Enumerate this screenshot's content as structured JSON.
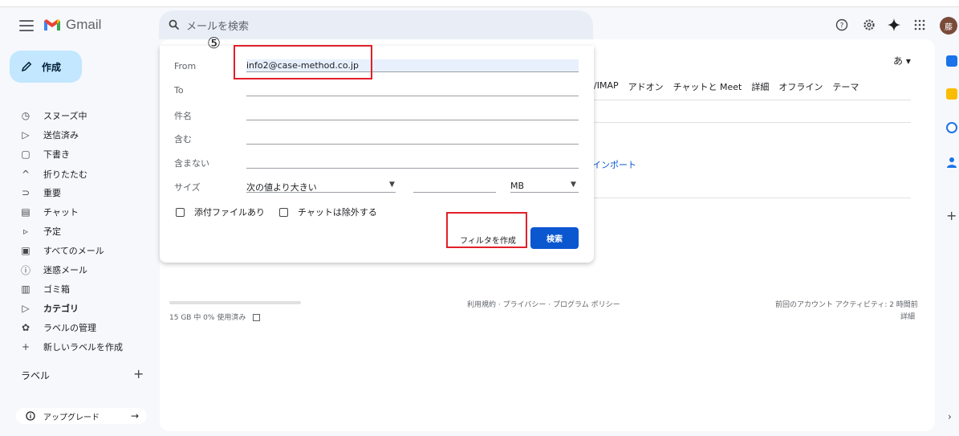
{
  "app": {
    "name": "Gmail"
  },
  "search": {
    "placeholder": "メールを検索"
  },
  "header": {
    "avatar_initial": "藤"
  },
  "sidebar": {
    "compose_label": "作成",
    "items": [
      {
        "label": "スヌーズ中",
        "icon": "clock-icon"
      },
      {
        "label": "送信済み",
        "icon": "send-icon"
      },
      {
        "label": "下書き",
        "icon": "draft-icon"
      },
      {
        "label": "折りたたむ",
        "icon": "chevron-up-icon"
      },
      {
        "label": "重要",
        "icon": "important-icon"
      },
      {
        "label": "チャット",
        "icon": "chat-icon"
      },
      {
        "label": "予定",
        "icon": "scheduled-icon"
      },
      {
        "label": "すべてのメール",
        "icon": "all-mail-icon"
      },
      {
        "label": "迷惑メール",
        "icon": "spam-icon"
      },
      {
        "label": "ゴミ箱",
        "icon": "trash-icon"
      },
      {
        "label": "カテゴリ",
        "icon": "label-icon"
      },
      {
        "label": "ラベルの管理",
        "icon": "gear-icon"
      },
      {
        "label": "新しいラベルを作成",
        "icon": "plus-icon"
      }
    ],
    "labels_heading": "ラベル",
    "upgrade_label": "アップグレード"
  },
  "main": {
    "lang_indicator": "あ",
    "tabs": [
      "/IMAP",
      "アドオン",
      "チャットと Meet",
      "詳細",
      "オフライン",
      "テーマ"
    ],
    "import_link": "インポート",
    "storage_text": "15 GB 中 0% 使用済み",
    "storage_fraction": 0.0,
    "footer_links": "利用規約 · プライバシー · プログラム ポリシー",
    "last_activity": "前回のアカウント アクティビティ: 2 時間前",
    "details_link": "詳細"
  },
  "filter": {
    "from_label": "From",
    "from_value": "info2@case-method.co.jp",
    "to_label": "To",
    "subject_label": "件名",
    "has_words_label": "含む",
    "doesnt_have_label": "含まない",
    "size_label": "サイズ",
    "size_operator": "次の値より大きい",
    "size_unit": "MB",
    "has_attachment_label": "添付ファイルあり",
    "exclude_chats_label": "チャットは除外する",
    "create_filter_label": "フィルタを作成",
    "search_button_label": "検索"
  },
  "annotation": {
    "step_marker": "⑤",
    "highlight_color": "#e0202a"
  }
}
